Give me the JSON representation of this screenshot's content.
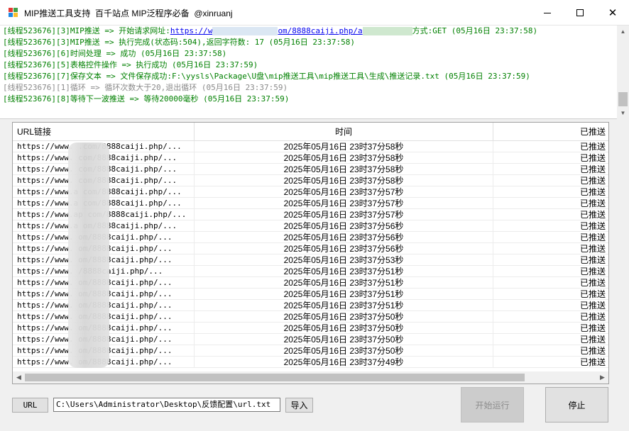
{
  "window": {
    "title": "MIP推送工具支持  百千站点 MIP泛程序必备  @xinruanj",
    "icon": "app-icon",
    "controls": {
      "minimize": "minimize-icon",
      "maximize": "maximize-icon",
      "close": "close-icon",
      "close_glyph": "✕"
    }
  },
  "log": {
    "lines": [
      {
        "pre": "[线程523676][3]MIP推送 => 开始请求网址:",
        "link_a": "https://w",
        "link_b": "om/8888caiji.php/a",
        "post": "方式:GET (05月16日 23:37:58)",
        "color": "green"
      },
      {
        "text": "[线程523676][3]MIP推送 => 执行完成(状态码:504),返回字符数: 17 (05月16日 23:37:58)",
        "color": "green"
      },
      {
        "text": "[线程523676][6]时间处理 => 成功 (05月16日 23:37:58)",
        "color": "green"
      },
      {
        "text": "[线程523676][5]表格控件操作 => 执行成功 (05月16日 23:37:59)",
        "color": "green"
      },
      {
        "text": "[线程523676][7]保存文本 => 文件保存成功:F:\\yysls\\Package\\U盘\\mip推送工具\\mip推送工具\\生成\\推送记录.txt (05月16日 23:37:59)",
        "color": "green"
      },
      {
        "text": "[线程523676][1]循环 => 循环次数大于20,退出循环 (05月16日 23:37:59)",
        "color": "gray"
      },
      {
        "text": "[线程523676][8]等待下一波推送 => 等待20000毫秒 (05月16日 23:37:59)",
        "color": "green"
      }
    ],
    "colors": {
      "green": "#008000",
      "gray": "#8a8a8a",
      "link": "#0000ee"
    }
  },
  "grid": {
    "columns": [
      "URL链接",
      "时间",
      "已推送"
    ],
    "rows": [
      {
        "url": "https://www.          .com/8888caiji.php/...",
        "time": "2025年05月16日 23时37分58秒",
        "status": "已推送"
      },
      {
        "url": "https://www.          com/8888caiji.php/...",
        "time": "2025年05月16日 23时37分58秒",
        "status": "已推送"
      },
      {
        "url": "https://www.          com/8888caiji.php/...",
        "time": "2025年05月16日 23时37分58秒",
        "status": "已推送"
      },
      {
        "url": "https://www.          com/8888caiji.php/...",
        "time": "2025年05月16日 23时37分58秒",
        "status": "已推送"
      },
      {
        "url": "https://www.a         com/8888caiji.php/...",
        "time": "2025年05月16日 23时37分57秒",
        "status": "已推送"
      },
      {
        "url": "https://www.a         com/8888caiji.php/...",
        "time": "2025年05月16日 23时37分57秒",
        "status": "已推送"
      },
      {
        "url": "https://www.ap        com/8888caiji.php/...",
        "time": "2025年05月16日 23时37分57秒",
        "status": "已推送"
      },
      {
        "url": "https://www.a         om/8888caiji.php/...",
        "time": "2025年05月16日 23时37分56秒",
        "status": "已推送"
      },
      {
        "url": "https://www.          om/8888caiji.php/...",
        "time": "2025年05月16日 23时37分56秒",
        "status": "已推送"
      },
      {
        "url": "https://www.          om/8888caiji.php/...",
        "time": "2025年05月16日 23时37分56秒",
        "status": "已推送"
      },
      {
        "url": "https://www.          om/8888caiji.php/...",
        "time": "2025年05月16日 23时37分53秒",
        "status": "已推送"
      },
      {
        "url": "https://www.          /8888caiji.php/...",
        "time": "2025年05月16日 23时37分51秒",
        "status": "已推送"
      },
      {
        "url": "https://www.          om/8888caiji.php/...",
        "time": "2025年05月16日 23时37分51秒",
        "status": "已推送"
      },
      {
        "url": "https://www.          om/8888caiji.php/...",
        "time": "2025年05月16日 23时37分51秒",
        "status": "已推送"
      },
      {
        "url": "https://www.          om/8888caiji.php/...",
        "time": "2025年05月16日 23时37分51秒",
        "status": "已推送"
      },
      {
        "url": "https://www.          om/8888caiji.php/...",
        "time": "2025年05月16日 23时37分50秒",
        "status": "已推送"
      },
      {
        "url": "https://www.          om/8888caiji.php/...",
        "time": "2025年05月16日 23时37分50秒",
        "status": "已推送"
      },
      {
        "url": "https://www.          om/8888caiji.php/...",
        "time": "2025年05月16日 23时37分50秒",
        "status": "已推送"
      },
      {
        "url": "https://www.          om/8888caiji.php/...",
        "time": "2025年05月16日 23时37分50秒",
        "status": "已推送"
      },
      {
        "url": "https://www.          om/8888caiji.php/...",
        "time": "2025年05月16日 23时37分49秒",
        "status": "已推送"
      }
    ]
  },
  "controls": {
    "url_button": "URL",
    "path_value": "C:\\Users\\Administrator\\Desktop\\反馈配置\\url.txt",
    "import_button": "导入",
    "start_button": "开始运行",
    "stop_button": "停止"
  },
  "icons": {
    "scroll_up": "▲",
    "scroll_down": "▼",
    "scroll_left": "◀",
    "scroll_right": "▶"
  }
}
